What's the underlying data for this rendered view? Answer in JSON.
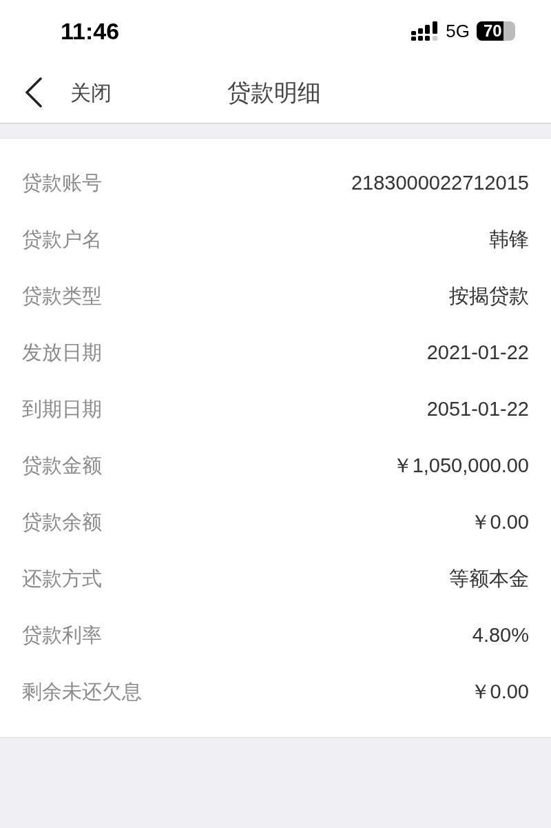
{
  "status_bar": {
    "time": "11:46",
    "network": "5G",
    "battery": "70"
  },
  "nav": {
    "back_label": "关闭",
    "title": "贷款明细"
  },
  "details": [
    {
      "label": "贷款账号",
      "value": "2183000022712015"
    },
    {
      "label": "贷款户名",
      "value": "韩锋"
    },
    {
      "label": "贷款类型",
      "value": "按揭贷款"
    },
    {
      "label": "发放日期",
      "value": "2021-01-22"
    },
    {
      "label": "到期日期",
      "value": "2051-01-22"
    },
    {
      "label": "贷款金额",
      "value": "￥1,050,000.00"
    },
    {
      "label": "贷款余额",
      "value": "￥0.00"
    },
    {
      "label": "还款方式",
      "value": "等额本金"
    },
    {
      "label": "贷款利率",
      "value": "4.80%"
    },
    {
      "label": "剩余未还欠息",
      "value": "￥0.00"
    }
  ]
}
